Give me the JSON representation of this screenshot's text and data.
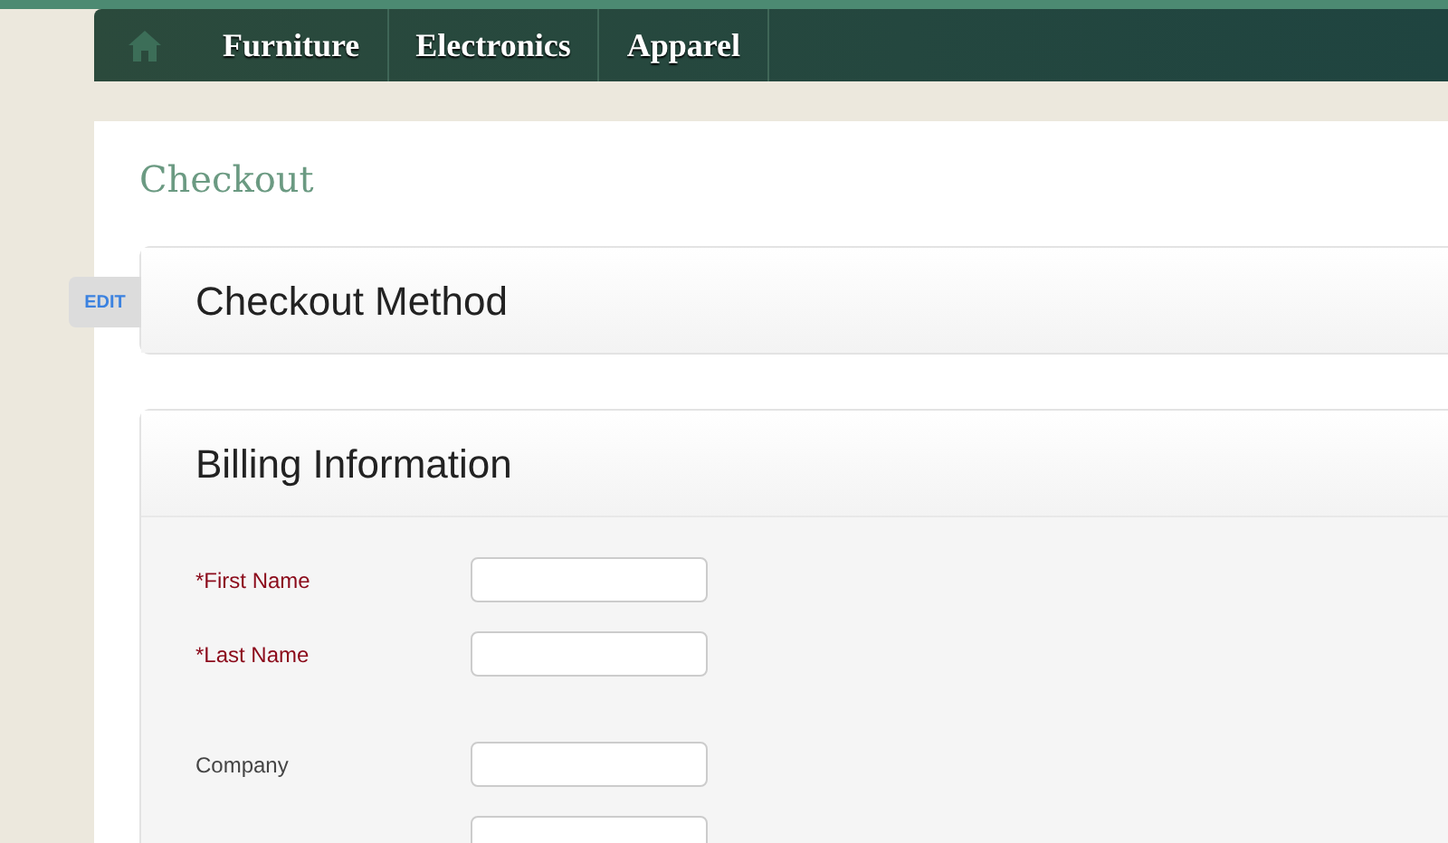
{
  "nav": {
    "items": [
      {
        "label": "Furniture"
      },
      {
        "label": "Electronics"
      },
      {
        "label": "Apparel"
      }
    ]
  },
  "page_title": "Checkout",
  "sections": [
    {
      "title": "Checkout Method",
      "edit_label": "EDIT",
      "expanded": false
    },
    {
      "title": "Billing Information",
      "expanded": true,
      "field_groups": [
        [
          {
            "kind": "labeled",
            "label": "*First Name",
            "required": true
          },
          {
            "kind": "labeled",
            "label": "*Last Name",
            "required": true
          }
        ],
        [
          {
            "kind": "labeled",
            "label": "Company",
            "required": false
          },
          {
            "kind": "bare"
          }
        ]
      ]
    }
  ]
}
